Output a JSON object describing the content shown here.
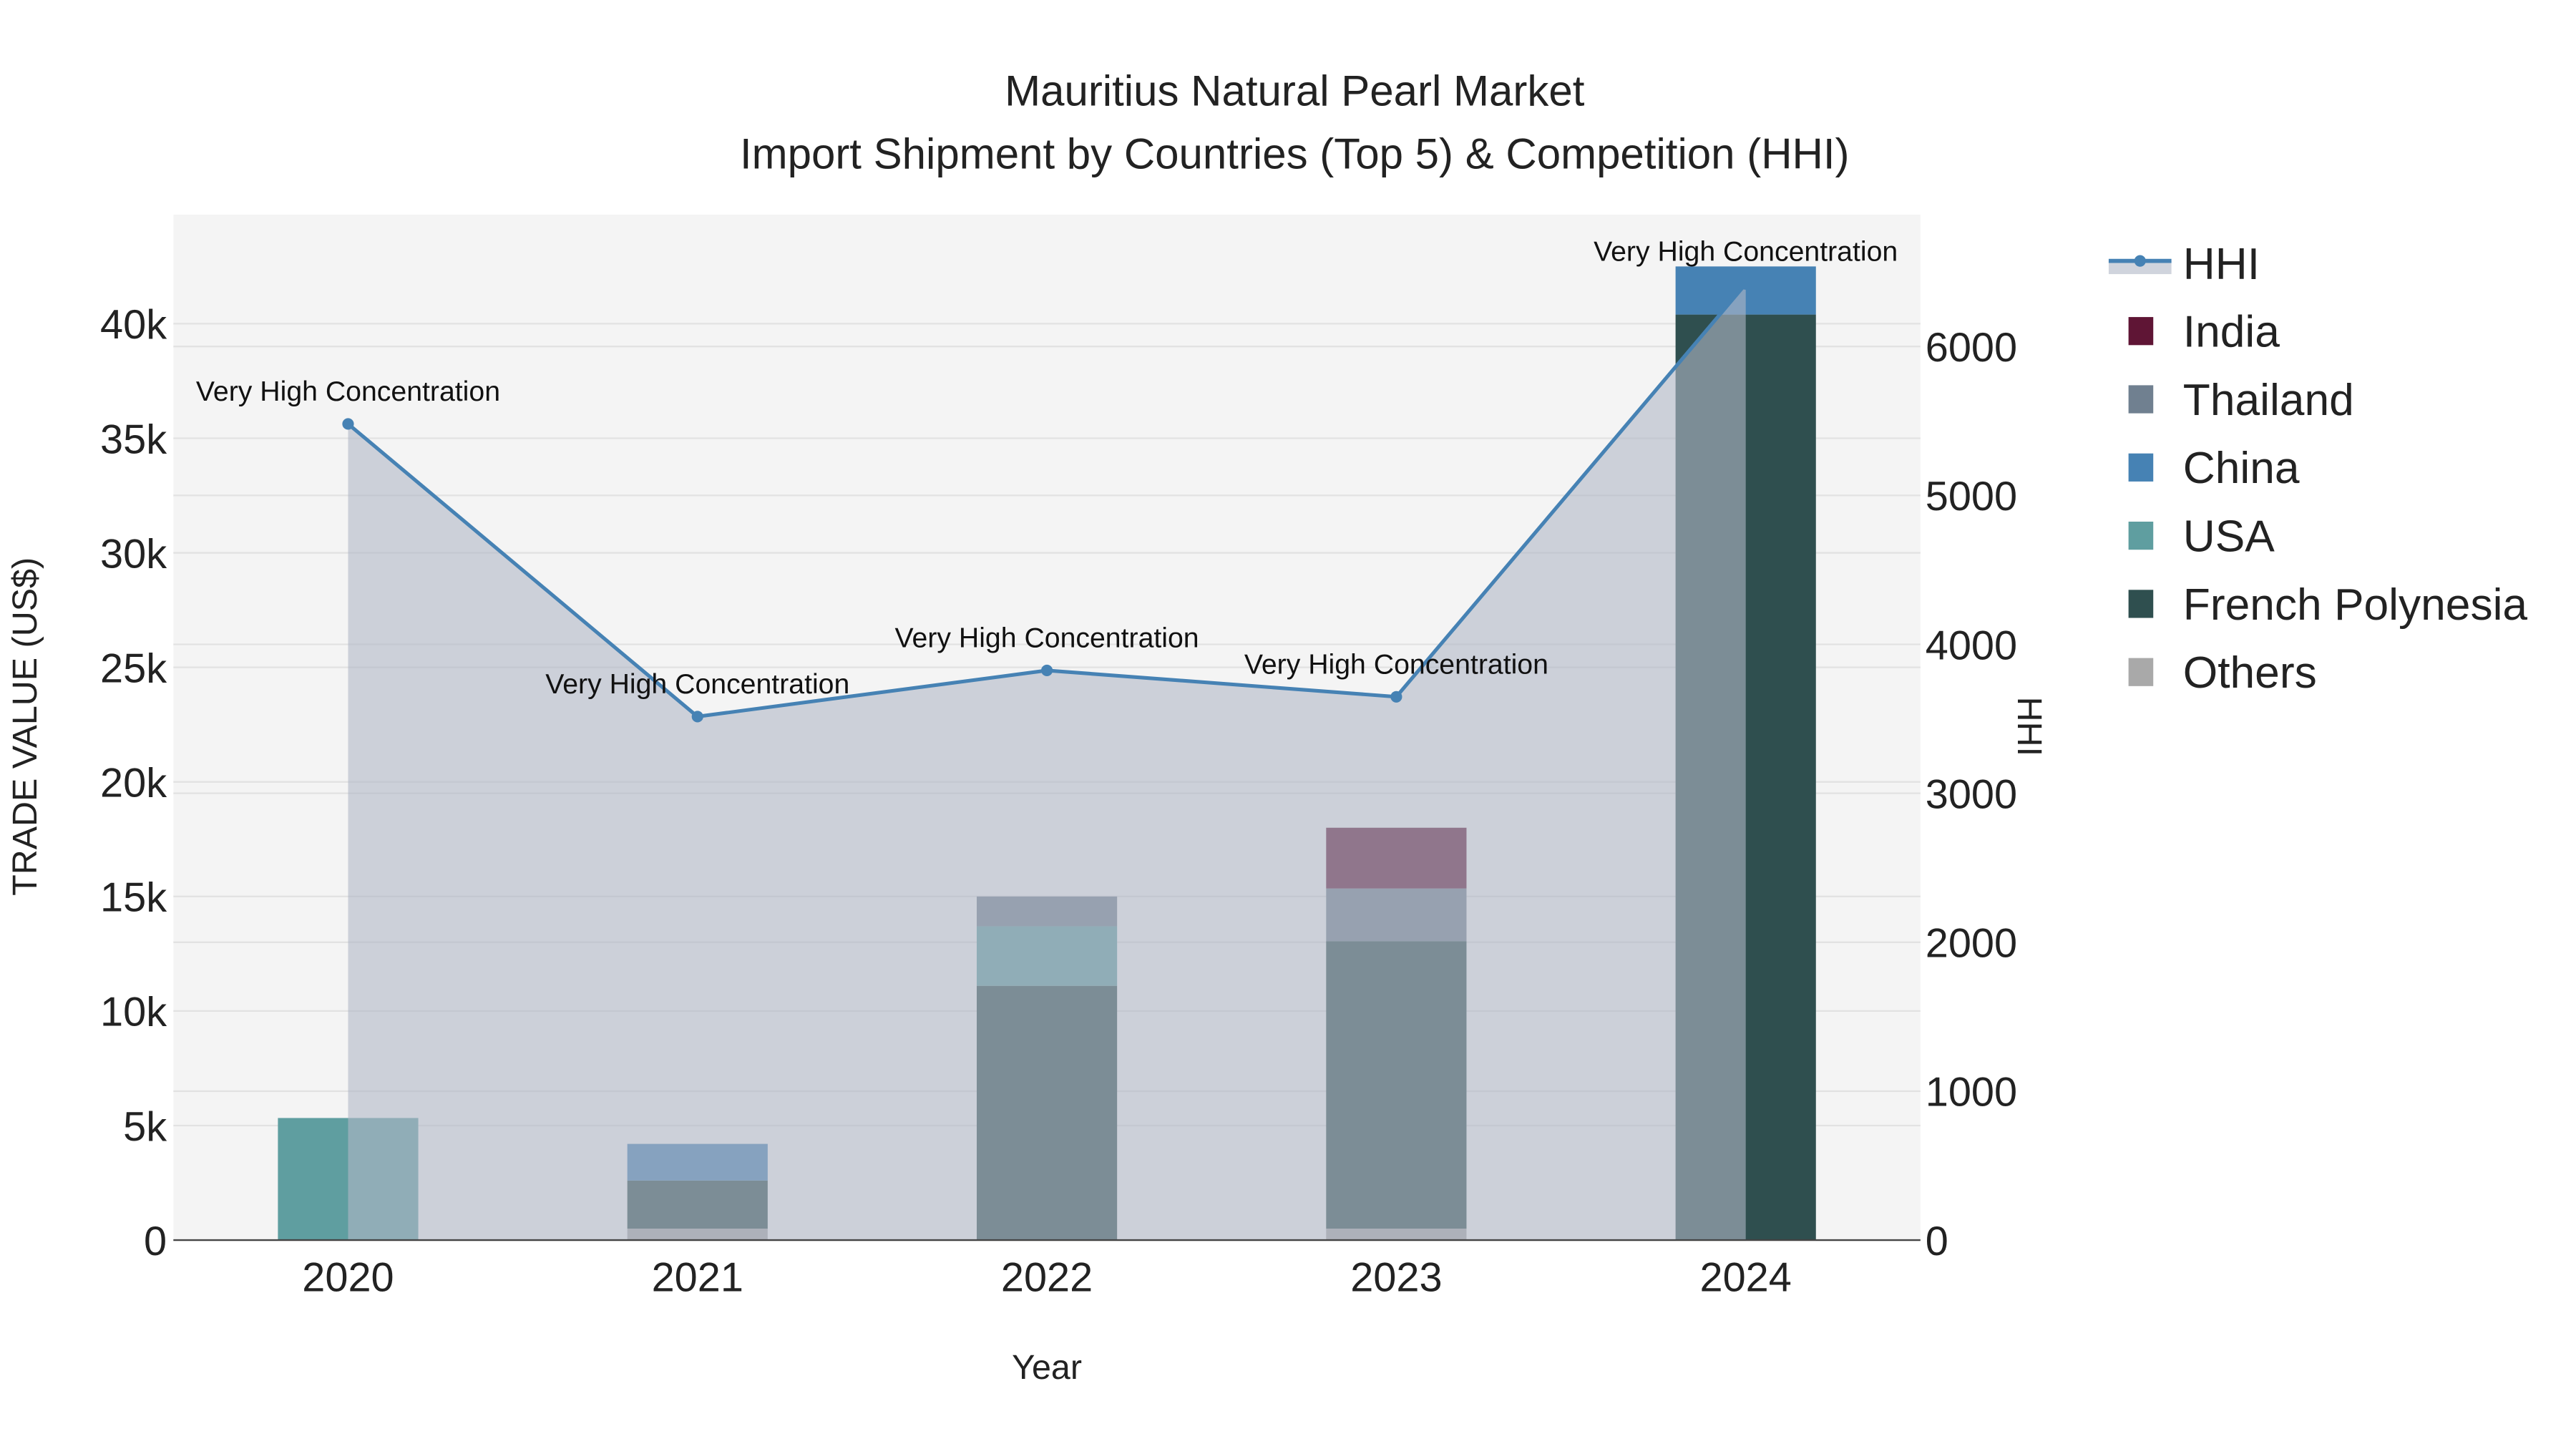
{
  "chart_data": {
    "type": "bar",
    "title": "Mauritius Natural Pearl Market",
    "subtitle": "Import Shipment by Countries (Top 5) & Competition (HHI)",
    "xlabel": "Year",
    "ylabel": "TRADE VALUE (US$)",
    "y2label": "HHI",
    "categories": [
      "2020",
      "2021",
      "2022",
      "2023",
      "2024"
    ],
    "ylim": [
      0,
      44760
    ],
    "y2lim": [
      0,
      6885
    ],
    "yticks": [
      0,
      5000,
      10000,
      15000,
      20000,
      25000,
      30000,
      35000,
      40000
    ],
    "yticklabels": [
      "0",
      "5k",
      "10k",
      "15k",
      "20k",
      "25k",
      "30k",
      "35k",
      "40k"
    ],
    "y2ticks": [
      0,
      1000,
      2000,
      3000,
      4000,
      5000,
      6000
    ],
    "y2ticklabels": [
      "0",
      "1000",
      "2000",
      "3000",
      "4000",
      "5000",
      "6000"
    ],
    "grid": true,
    "legend_position": "right",
    "stack_order": [
      "Others",
      "French Polynesia",
      "USA",
      "China",
      "Thailand",
      "India"
    ],
    "series": [
      {
        "name": "India",
        "color": "#5f1535",
        "values": [
          0,
          0,
          0,
          2650,
          0
        ]
      },
      {
        "name": "Thailand",
        "color": "#708090",
        "values": [
          0,
          0,
          1300,
          2300,
          0
        ]
      },
      {
        "name": "China",
        "color": "#4682b4",
        "values": [
          0,
          1600,
          0,
          0,
          2100
        ]
      },
      {
        "name": "USA",
        "color": "#5f9ea0",
        "values": [
          5330,
          0,
          2600,
          0,
          0
        ]
      },
      {
        "name": "French Polynesia",
        "color": "#2f4f4f",
        "values": [
          0,
          2100,
          11100,
          12550,
          40400
        ]
      },
      {
        "name": "Others",
        "color": "#a9a9a9",
        "values": [
          0,
          500,
          0,
          500,
          0
        ]
      }
    ],
    "hhi": {
      "name": "HHI",
      "color": "#4682b4",
      "values": [
        5480,
        3515,
        3825,
        3648,
        6420
      ],
      "annotations": [
        "Very High Concentration",
        "Very High Concentration",
        "Very High Concentration",
        "Very High Concentration",
        "Very High Concentration"
      ]
    }
  }
}
